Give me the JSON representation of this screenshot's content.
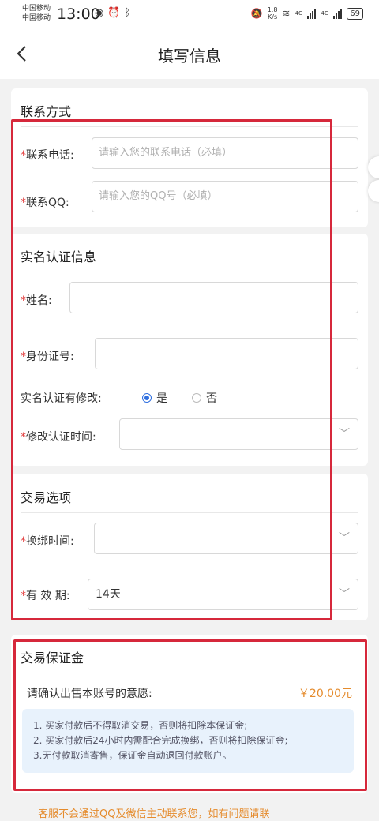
{
  "status": {
    "carrier1": "中国移动",
    "carrier2": "中国移动",
    "time": "13:00",
    "speed": "1.8\nK/s",
    "net1": "4G",
    "net2": "4G",
    "battery": "69"
  },
  "nav": {
    "back": "<",
    "title": "填写信息"
  },
  "contact": {
    "title": "联系方式",
    "phone_label": "联系电话:",
    "phone_placeholder": "请输入您的联系电话（必填）",
    "qq_label": "联系QQ:",
    "qq_placeholder": "请输入您的QQ号（必填）"
  },
  "realname": {
    "title": "实名认证信息",
    "name_label": "姓名:",
    "id_label": "身份证号:",
    "modified_label": "实名认证有修改:",
    "opt_yes": "是",
    "opt_no": "否",
    "modified_selected": "是",
    "modtime_label": "修改认证时间:"
  },
  "trade": {
    "title": "交易选项",
    "rebind_label": "换绑时间:",
    "validity_label": "有 效 期:",
    "validity_value": "14天"
  },
  "deposit": {
    "title": "交易保证金",
    "confirm_text": "请确认出售本账号的意愿:",
    "amount": "￥20.00元",
    "notes": [
      "1. 买家付款后不得取消交易，否则将扣除本保证金;",
      "2. 买家付款后24小时内需配合完成换绑，否则将扣除保证金;",
      "3.无付款取消寄售，保证金自动退回付款账户。"
    ]
  },
  "footer": "客服不会通过QQ及微信主动联系您，如有问题请联",
  "required_mark": "*",
  "colors": {
    "required": "#e23c3c",
    "highlight": "#d6283b",
    "amount": "#e58b2c",
    "radio": "#2f6fe0"
  }
}
